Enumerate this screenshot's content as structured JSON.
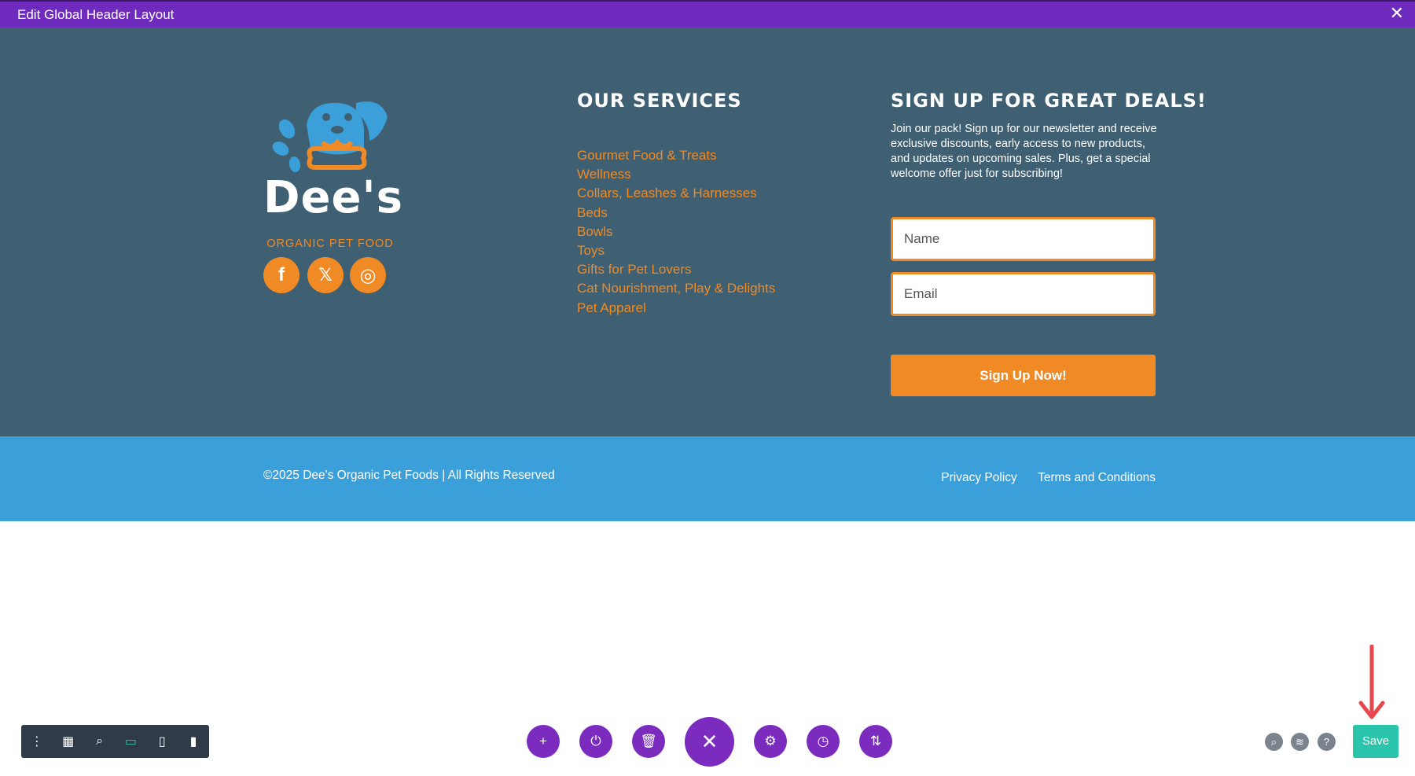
{
  "editor": {
    "title": "Edit Global Header Layout",
    "close_glyph": "✕"
  },
  "logo": {
    "brand": "Dee's",
    "sub": "ORGANIC PET FOOD"
  },
  "social": [
    {
      "name": "facebook-icon",
      "glyph": "f"
    },
    {
      "name": "x-twitter-icon",
      "glyph": "𝕏"
    },
    {
      "name": "instagram-icon",
      "glyph": "◎"
    }
  ],
  "services": {
    "title": "Our Services",
    "items": [
      "Gourmet Food & Treats",
      "Wellness",
      "Collars, Leashes & Harnesses",
      "Beds",
      "Bowls",
      "Toys",
      "Gifts for Pet Lovers",
      "Cat Nourishment, Play & Delights",
      "Pet Apparel"
    ]
  },
  "signup": {
    "title": "Sign Up for Great Deals!",
    "text": "Join our pack! Sign up for our newsletter and receive exclusive discounts, early access to new products, and updates on upcoming sales. Plus, get a special welcome offer just for subscribing!",
    "name_placeholder": "Name",
    "email_placeholder": "Email",
    "button": "Sign Up Now!"
  },
  "bottom": {
    "copyright": "©2025 Dee's Organic Pet Foods | All Rights Reserved",
    "privacy": "Privacy Policy",
    "terms": "Terms and Conditions"
  },
  "toolbar": {
    "save_label": "Save"
  },
  "colors": {
    "purple": "#6f2bbd",
    "footer_bg": "#3f5f72",
    "orange": "#f08a24",
    "blue": "#3ba0da",
    "teal": "#29c4a9"
  }
}
